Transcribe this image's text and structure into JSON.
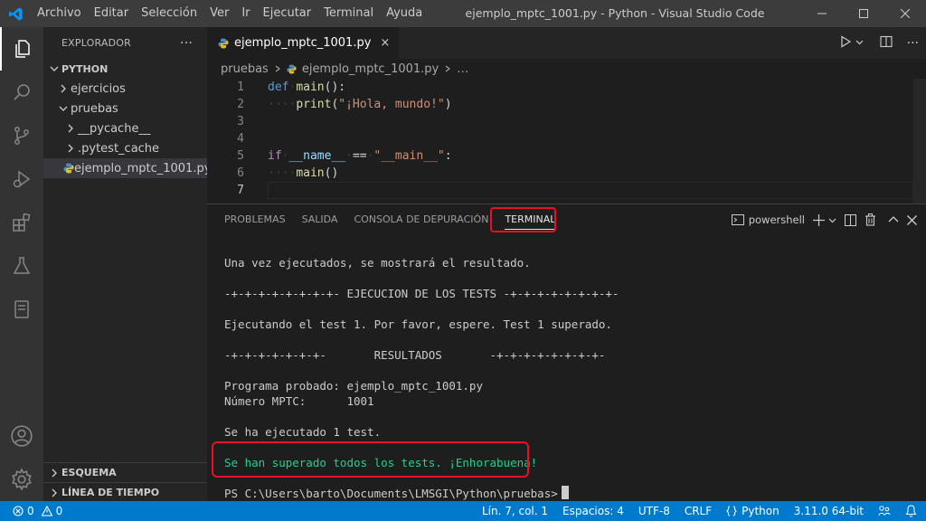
{
  "titlebar": {
    "menu": [
      "Archivo",
      "Editar",
      "Selección",
      "Ver",
      "Ir",
      "Terminal",
      "Ayuda"
    ],
    "menu_ejecutar": "Ejecutar",
    "window_title": "ejemplo_mptc_1001.py - Python - Visual Studio Code"
  },
  "sidebar": {
    "header": "EXPLORADOR",
    "more": "···",
    "root": "PYTHON",
    "items": [
      {
        "label": "ejercicios"
      },
      {
        "label": "pruebas"
      },
      {
        "label": "__pycache__"
      },
      {
        "label": ".pytest_cache"
      },
      {
        "label": "ejemplo_mptc_1001.py"
      }
    ],
    "outline": "ESQUEMA",
    "timeline": "LÍNEA DE TIEMPO"
  },
  "editor": {
    "tab_label": "ejemplo_mptc_1001.py",
    "tab_close": "×",
    "breadcrumb_folder": "pruebas",
    "breadcrumb_file": "ejemplo_mptc_1001.py",
    "breadcrumb_more": "…",
    "line_numbers": [
      "1",
      "2",
      "3",
      "4",
      "5",
      "6",
      "7"
    ],
    "code": {
      "l1_kw": "def",
      "l1_fn": "main",
      "l1_rest": "():",
      "l2_fn": "print",
      "l2_open": "(",
      "l2_str": "\"¡Hola, mundo!\"",
      "l2_close": ")",
      "l5_kw": "if",
      "l5_var": "__name__",
      "l5_op": "==",
      "l5_str": "\"__main__\"",
      "l5_colon": ":",
      "l6_fn": "main",
      "l6_rest": "()"
    }
  },
  "panel": {
    "tabs": [
      "PROBLEMAS",
      "SALIDA",
      "CONSOLA DE DEPURACIÓN",
      "TERMINAL"
    ],
    "shell": "powershell",
    "lines": [
      "Una vez ejecutados, se mostrará el resultado.",
      "-+-+-+-+-+-+-+-+- EJECUCION DE LOS TESTS -+-+-+-+-+-+-+-+-",
      "Ejecutando el test 1. Por favor, espere. Test 1 superado.",
      "-+-+-+-+-+-+-+-       RESULTADOS       -+-+-+-+-+-+-+-+-",
      "Programa probado: ejemplo_mptc_1001.py",
      "Número MPTC:      1001",
      "Se ha ejecutado 1 test."
    ],
    "success": "Se han superado todos los tests. ¡Enhorabuena!",
    "prompt": "PS C:\\Users\\barto\\Documents\\LMSGI\\Python\\pruebas>"
  },
  "status": {
    "errors": "0",
    "warnings": "0",
    "position": "Lín. 7, col. 1",
    "spaces": "Espacios: 4",
    "encoding": "UTF-8",
    "eol": "CRLF",
    "language": "Python",
    "interpreter": "3.11.0 64-bit"
  },
  "colors": {
    "accent": "#007acc",
    "highlight": "#e81123",
    "success_text": "#23d18b"
  }
}
